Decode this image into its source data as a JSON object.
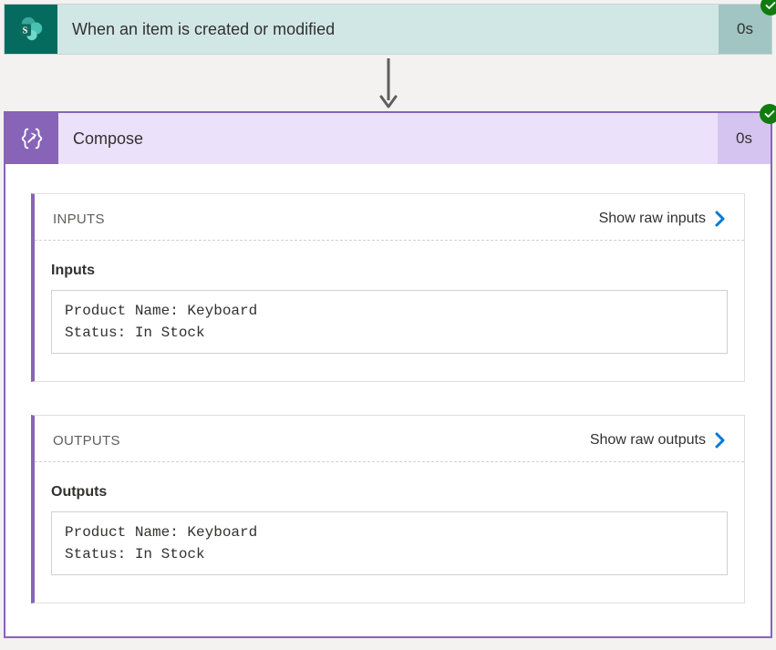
{
  "trigger": {
    "title": "When an item is created or modified",
    "duration": "0s"
  },
  "compose": {
    "title": "Compose",
    "duration": "0s",
    "inputs": {
      "header_label": "INPUTS",
      "show_raw_label": "Show raw inputs",
      "sub_label": "Inputs",
      "content": "Product Name: Keyboard\nStatus: In Stock"
    },
    "outputs": {
      "header_label": "OUTPUTS",
      "show_raw_label": "Show raw outputs",
      "sub_label": "Outputs",
      "content": "Product Name: Keyboard\nStatus: In Stock"
    }
  }
}
